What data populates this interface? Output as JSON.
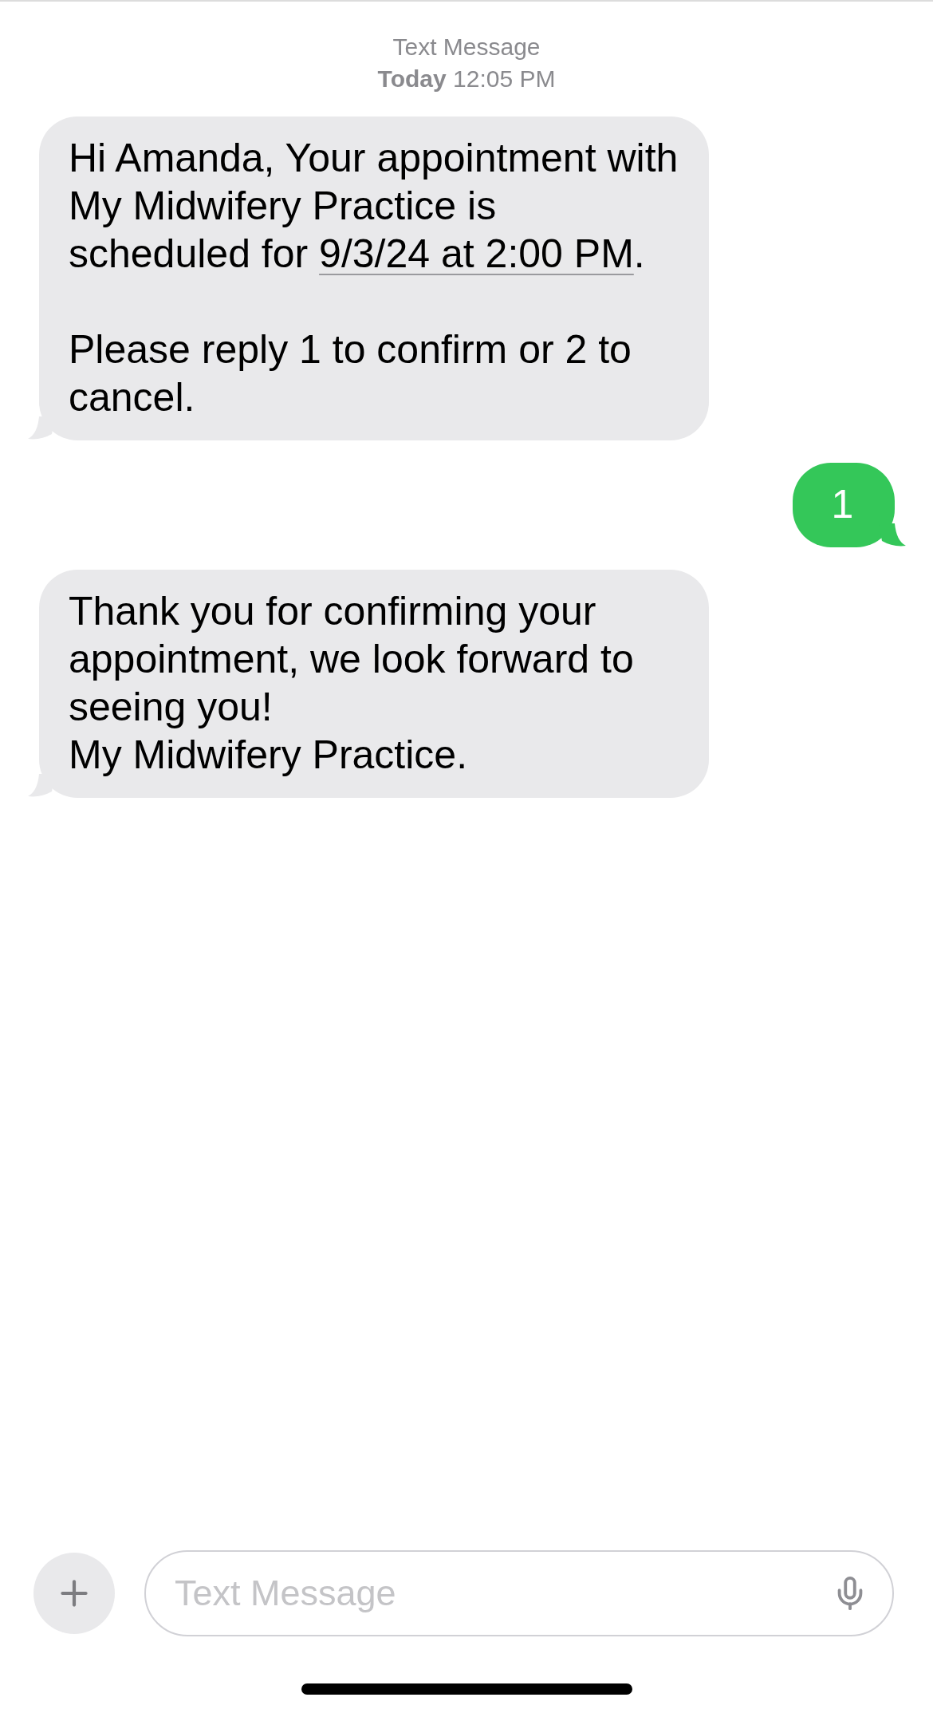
{
  "header": {
    "service": "Text Message",
    "timestamp": "**Today** 12:05 PM"
  },
  "messages": [
    {
      "kind": "received",
      "paragraphs": [
        {
          "lines": [
            [
              {
                "kind": "text",
                "text": "Hi Amanda, Your appointment with My Midwifery Practice is scheduled for "
              },
              {
                "kind": "link",
                "text": "9/3/24 at 2:00 PM"
              },
              {
                "kind": "text",
                "text": "."
              }
            ]
          ]
        },
        {
          "lines": [
            [
              {
                "kind": "text",
                "text": "Please reply 1 to confirm or 2 to cancel."
              }
            ]
          ]
        }
      ]
    },
    {
      "kind": "sent",
      "paragraphs": [
        {
          "lines": [
            [
              {
                "kind": "text",
                "text": "1"
              }
            ]
          ]
        }
      ]
    },
    {
      "kind": "received",
      "paragraphs": [
        {
          "lines": [
            [
              {
                "kind": "text",
                "text": "Thank you for confirming your appointment, we look forward to seeing you!"
              }
            ],
            [
              {
                "kind": "text",
                "text": "My Midwifery Practice."
              }
            ]
          ]
        }
      ]
    }
  ],
  "composer": {
    "placeholder": "Text Message"
  }
}
